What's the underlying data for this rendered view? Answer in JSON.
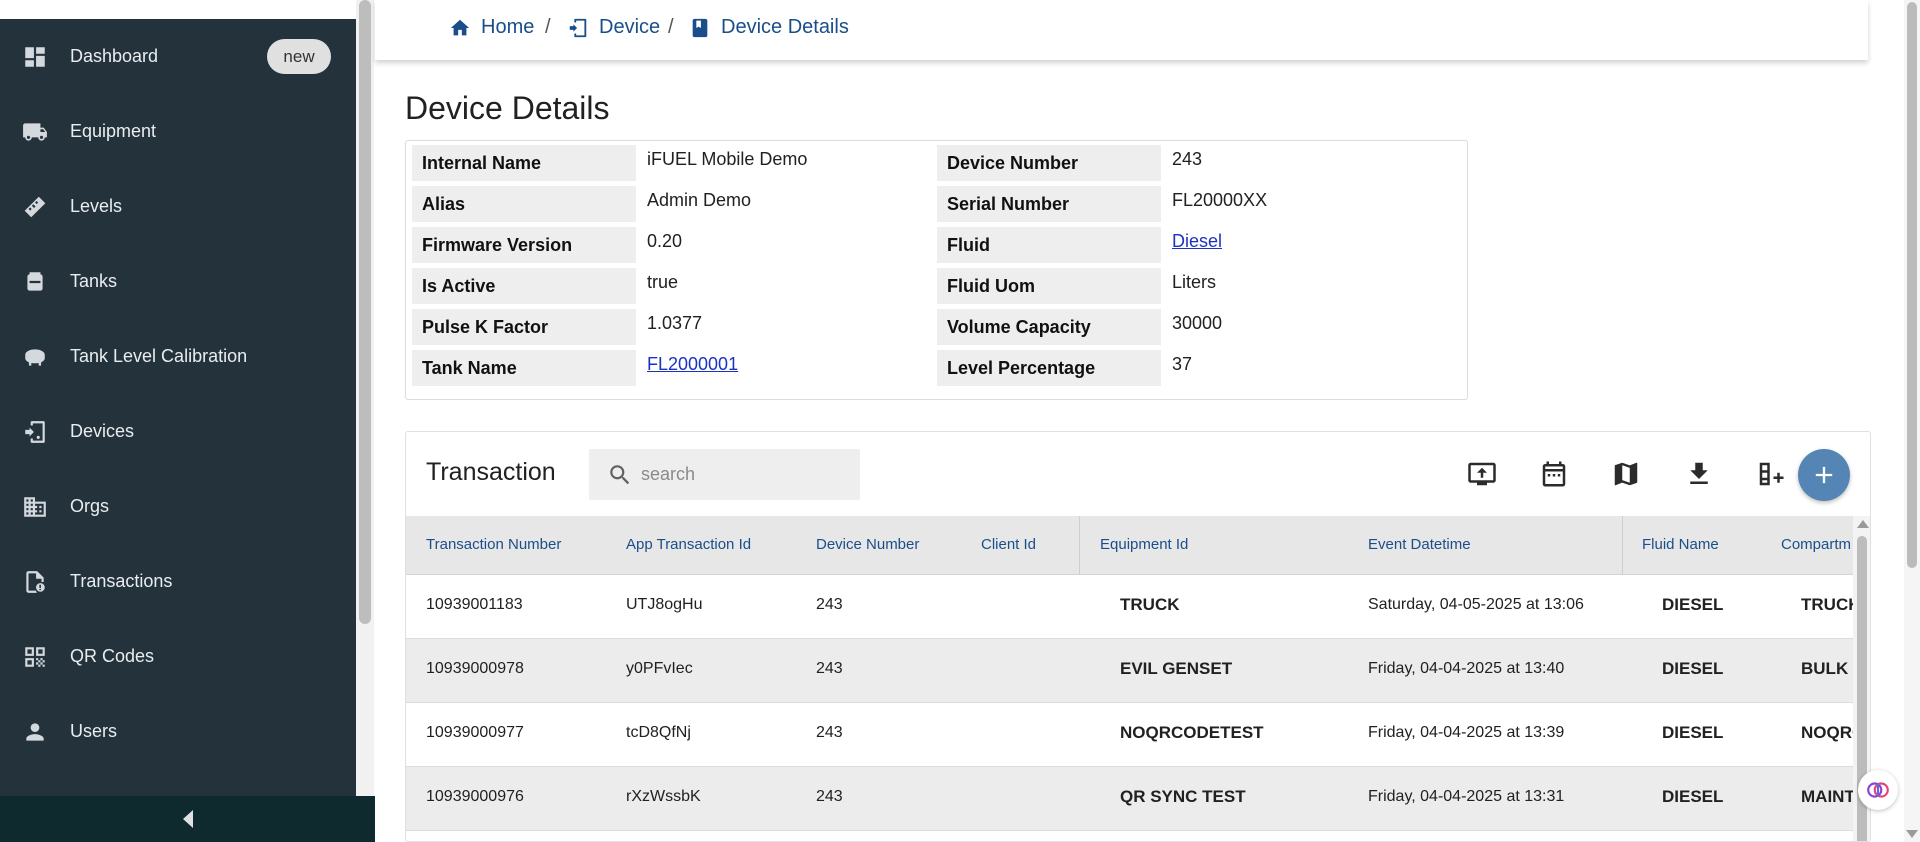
{
  "sidebar": {
    "items": [
      {
        "label": "Dashboard",
        "icon": "dashboard-icon",
        "badge": "new"
      },
      {
        "label": "Equipment",
        "icon": "truck-icon"
      },
      {
        "label": "Levels",
        "icon": "ruler-icon"
      },
      {
        "label": "Tanks",
        "icon": "tank-icon"
      },
      {
        "label": "Tank Level Calibration",
        "icon": "calibration-icon"
      },
      {
        "label": "Devices",
        "icon": "device-icon"
      },
      {
        "label": "Orgs",
        "icon": "building-icon"
      },
      {
        "label": "Transactions",
        "icon": "document-icon"
      },
      {
        "label": "QR Codes",
        "icon": "qr-code-icon"
      },
      {
        "label": "Users",
        "icon": "user-icon"
      }
    ]
  },
  "breadcrumb": [
    {
      "label": "Home",
      "icon": "home-icon"
    },
    {
      "label": "Device",
      "icon": "device-icon"
    },
    {
      "label": "Device Details",
      "icon": "device-details-icon"
    }
  ],
  "breadcrumb_separator": "/",
  "page_title": "Device Details",
  "details": {
    "left": [
      {
        "label": "Internal Name",
        "value": "iFUEL Mobile Demo"
      },
      {
        "label": "Alias",
        "value": "Admin Demo"
      },
      {
        "label": "Firmware Version",
        "value": "0.20"
      },
      {
        "label": "Is Active",
        "value": "true"
      },
      {
        "label": "Pulse K Factor",
        "value": "1.0377"
      },
      {
        "label": "Tank Name",
        "value": "FL2000001",
        "link": true
      }
    ],
    "right": [
      {
        "label": "Device Number",
        "value": "243"
      },
      {
        "label": "Serial Number",
        "value": "FL20000XX"
      },
      {
        "label": "Fluid",
        "value": "Diesel",
        "link": true
      },
      {
        "label": "Fluid Uom",
        "value": "Liters"
      },
      {
        "label": "Volume Capacity",
        "value": "30000"
      },
      {
        "label": "Level Percentage",
        "value": "37"
      }
    ]
  },
  "transactions": {
    "title": "Transaction",
    "search_placeholder": "search",
    "toolbar_icons": [
      "upload-icon",
      "calendar-icon",
      "map-icon",
      "download-icon",
      "add-column-icon"
    ],
    "columns": [
      "Transaction Number",
      "App Transaction Id",
      "Device Number",
      "Client Id",
      "Equipment Id",
      "Event Datetime",
      "Fluid Name",
      "Compartm"
    ],
    "rows": [
      {
        "transaction_number": "10939001183",
        "app_transaction_id": "UTJ8ogHu",
        "device_number": "243",
        "client_id": "",
        "equipment_id": "TRUCK",
        "event_datetime": "Saturday, 04-05-2025 at 13:06",
        "fluid_name": "DIESEL",
        "compartment": "TRUCK"
      },
      {
        "transaction_number": "10939000978",
        "app_transaction_id": "y0PFvIec",
        "device_number": "243",
        "client_id": "",
        "equipment_id": "EVIL GENSET",
        "event_datetime": "Friday, 04-04-2025 at 13:40",
        "fluid_name": "DIESEL",
        "compartment": "BULK"
      },
      {
        "transaction_number": "10939000977",
        "app_transaction_id": "tcD8QfNj",
        "device_number": "243",
        "client_id": "",
        "equipment_id": "NOQRCODETEST",
        "event_datetime": "Friday, 04-04-2025 at 13:39",
        "fluid_name": "DIESEL",
        "compartment": "NOQRC"
      },
      {
        "transaction_number": "10939000976",
        "app_transaction_id": "rXzWssbK",
        "device_number": "243",
        "client_id": "",
        "equipment_id": "QR SYNC TEST",
        "event_datetime": "Friday, 04-04-2025 at 13:31",
        "fluid_name": "DIESEL",
        "compartment": "MAINT"
      }
    ]
  },
  "colors": {
    "sidebar_bg": "#24323c",
    "collapse_bar_bg": "#0e2a2f",
    "link": "#1a4e8a",
    "fab": "#5585b5"
  }
}
